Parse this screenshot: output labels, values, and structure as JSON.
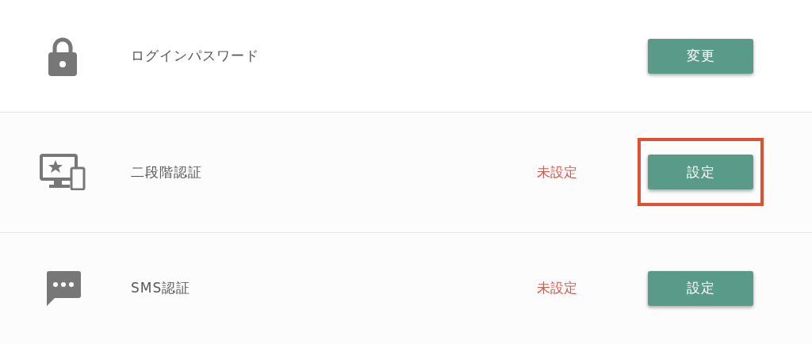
{
  "rows": [
    {
      "kind": "lock",
      "label": "ログインパスワード",
      "button": {
        "label": "変更",
        "highlighted": false
      }
    },
    {
      "kind": "devices",
      "label": "二段階認証",
      "status": "未設定",
      "button": {
        "label": "設定",
        "highlighted": true
      }
    },
    {
      "kind": "chat",
      "label": "SMS認証",
      "status": "未設定",
      "button": {
        "label": "設定",
        "highlighted": false
      }
    }
  ]
}
